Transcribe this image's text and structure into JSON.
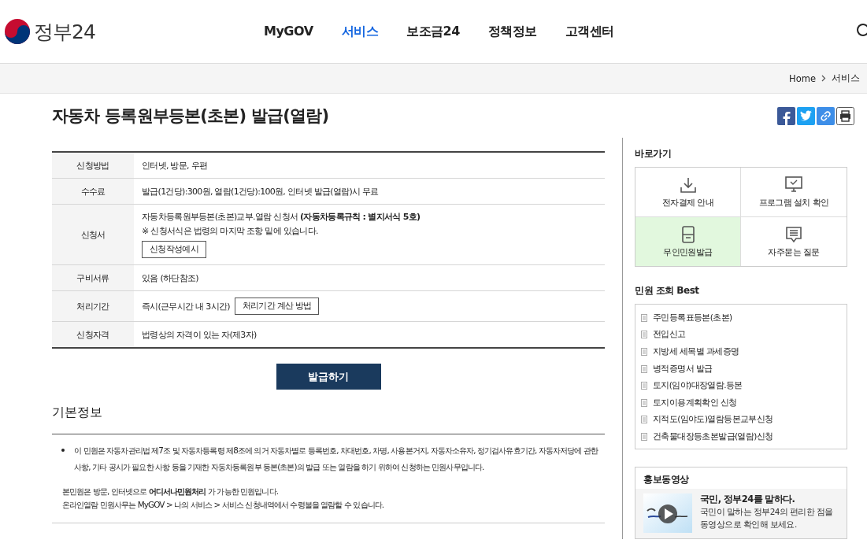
{
  "header": {
    "logo_text": "정부24",
    "nav": [
      {
        "label": "MyGOV",
        "selected": false
      },
      {
        "label": "서비스",
        "selected": true
      },
      {
        "label": "보조금24",
        "selected": false
      },
      {
        "label": "정책정보",
        "selected": false
      },
      {
        "label": "고객센터",
        "selected": false
      }
    ]
  },
  "breadcrumb": [
    "Home",
    "서비스"
  ],
  "page_title": "자동차 등록원부등본(초본) 발급(열람)",
  "info_table": [
    {
      "label": "신청방법",
      "value": "인터넷, 방문, 우편"
    },
    {
      "label": "수수료",
      "value": "발급(1건당):300원, 열람(1건당):100원, 인터넷 발급(열람)시 무료"
    },
    {
      "label": "신청서",
      "value": "자동차등록원부등본(초본)교부.열람 신청서 **(자동차등록규칙 : 별지서식 5호)**",
      "note": "※ 신청서식은 법령의 마지막 조항 밑에 있습니다.",
      "button": "신청작성예시",
      "button_inline": false
    },
    {
      "label": "구비서류",
      "value": "있음 (하단참조)"
    },
    {
      "label": "처리기간",
      "value": "즉시(근무시간 내 3시간)",
      "button": "처리기간 계산 방법",
      "button_inline": true
    },
    {
      "label": "신청자격",
      "value": "법령상의 자격이 있는 자(제3자)"
    }
  ],
  "apply_button": "발급하기",
  "basic_info": {
    "title": "기본정보",
    "bullet": "이 민원은 자동차관리법 제7조 및 자동차등록령 제8조에 의거 자동차별로 등록번호, 차대번호, 차명, 사용본거지, 자동차소유자, 정기검사유효기간, 자동차저당에 관한 사항, 기타 공시가 필요한 사항 등을 기재한 자동차등록원부 등본(초본)의 발급 또는 열람을 하기 위하여 신청하는 민원사무입니다.",
    "paragraphs": [
      "본민원은 방문, 인터넷으로 **어디서나민원처리** 가 가능한 민원입니다.",
      "온라인열람 민원사무는 MyGOV > 나의 서비스 > 서비스 신청내역에서 수령불을 열람할 수 있습니다."
    ]
  },
  "sidebar": {
    "quick_title": "바로가기",
    "quick_links": [
      {
        "label": "전자결제 안내",
        "kind": "download",
        "highlighted": false
      },
      {
        "label": "프로그램 설치 확인",
        "kind": "monitor",
        "highlighted": false
      },
      {
        "label": "무인민원발급",
        "kind": "kiosk",
        "highlighted": true
      },
      {
        "label": "자주묻는 질문",
        "kind": "chat",
        "highlighted": false
      }
    ],
    "best_title": "민원 조회 Best",
    "best_items": [
      "주민등록표등본(초본)",
      "전입신고",
      "지방세 세목별 과세증명",
      "병적증명서 발급",
      "토지(임야)대장열람.등본",
      "토지이용계획확인 신청",
      "지적도(임야도)열람등본교부신청",
      "건축물대장등초본발급(열람)신청"
    ],
    "video": {
      "title": "홍보동영상",
      "headline": "국민, 정부24를 말하다.",
      "text_lines": [
        "국민이 말하는 정부24의 편리한 점을",
        "동영상으로 확인해 보세요."
      ]
    }
  }
}
